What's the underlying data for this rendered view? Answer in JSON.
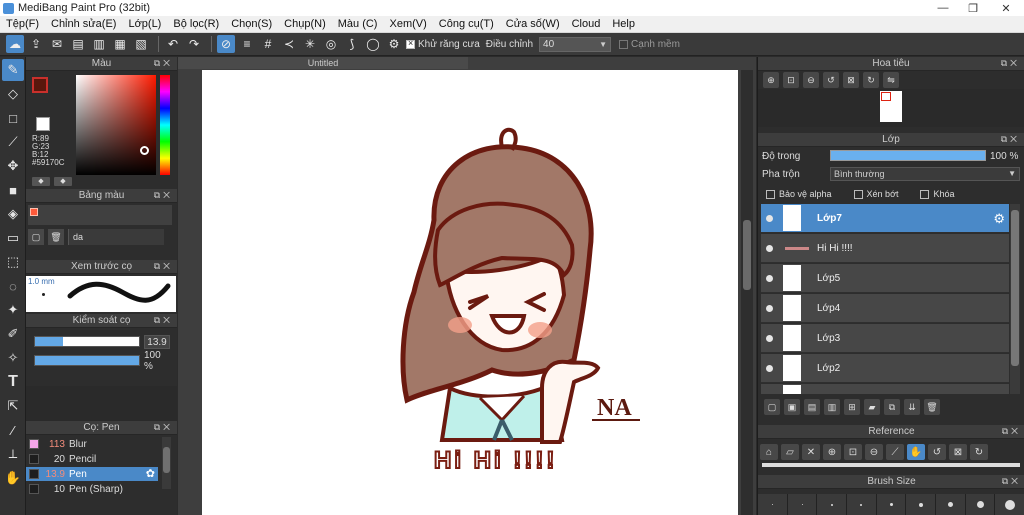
{
  "window": {
    "title": "MediBang Paint Pro (32bit)",
    "minimize": "—",
    "maximize": "❐",
    "close": "✕"
  },
  "menu": [
    "Tệp(F)",
    "Chỉnh sửa(E)",
    "Lớp(L)",
    "Bộ lọc(R)",
    "Chọn(S)",
    "Chụp(N)",
    "Màu (C)",
    "Xem(V)",
    "Công cụ(T)",
    "Cửa số(W)",
    "Cloud",
    "Help"
  ],
  "toolbar": {
    "antialias_label": "Khử răng cưa",
    "correction_label": "Điều chỉnh",
    "correction_value": "40",
    "sharp_edge_label": "Cạnh mềm"
  },
  "color_panel": {
    "title": "Màu",
    "r": "R:89",
    "g": "G:23",
    "b": "B:12",
    "hex": "#59170C",
    "main_color": "#59170c"
  },
  "palette_panel": {
    "title": "Bảng màu",
    "name": "da"
  },
  "preview_panel": {
    "title": "Xem trước cọ",
    "size": "1.0 mm"
  },
  "control_panel": {
    "title": "Kiểm soát cọ",
    "size_value": "13.9",
    "size_fraction": 0.27,
    "opacity_value": "100 %",
    "opacity_fraction": 1.0
  },
  "brush_panel": {
    "title": "Cọ: Pen",
    "items": [
      {
        "num": "113",
        "name": "Blur",
        "color": "#f3a6e8"
      },
      {
        "num": "20",
        "name": "Pencil",
        "color": "#1e1e1e"
      },
      {
        "num": "13.9",
        "name": "Pen",
        "color": "#1e1e1e",
        "active": true
      },
      {
        "num": "10",
        "name": "Pen (Sharp)",
        "color": "#1e1e1e"
      }
    ]
  },
  "canvas": {
    "tab_title": "Untitled",
    "art_text": "Hi Hi !!!!",
    "signature": "NA"
  },
  "navigator": {
    "title": "Hoa tiêu"
  },
  "layer_panel": {
    "title": "Lớp",
    "opacity_label": "Độ trong",
    "opacity_value": "100 %",
    "blend_label": "Pha trộn",
    "blend_value": "Bình thường",
    "protect_alpha": "Bảo vệ alpha",
    "clipping": "Xén bớt",
    "lock": "Khóa",
    "layers": [
      {
        "name": "Lớp7",
        "active": true
      },
      {
        "name": "Hi Hi !!!!",
        "text_thumb": true
      },
      {
        "name": "Lớp5"
      },
      {
        "name": "Lớp4"
      },
      {
        "name": "Lớp3"
      },
      {
        "name": "Lớp2"
      },
      {
        "name": ""
      }
    ]
  },
  "reference_panel": {
    "title": "Reference"
  },
  "brush_size_panel": {
    "title": "Brush Size"
  }
}
